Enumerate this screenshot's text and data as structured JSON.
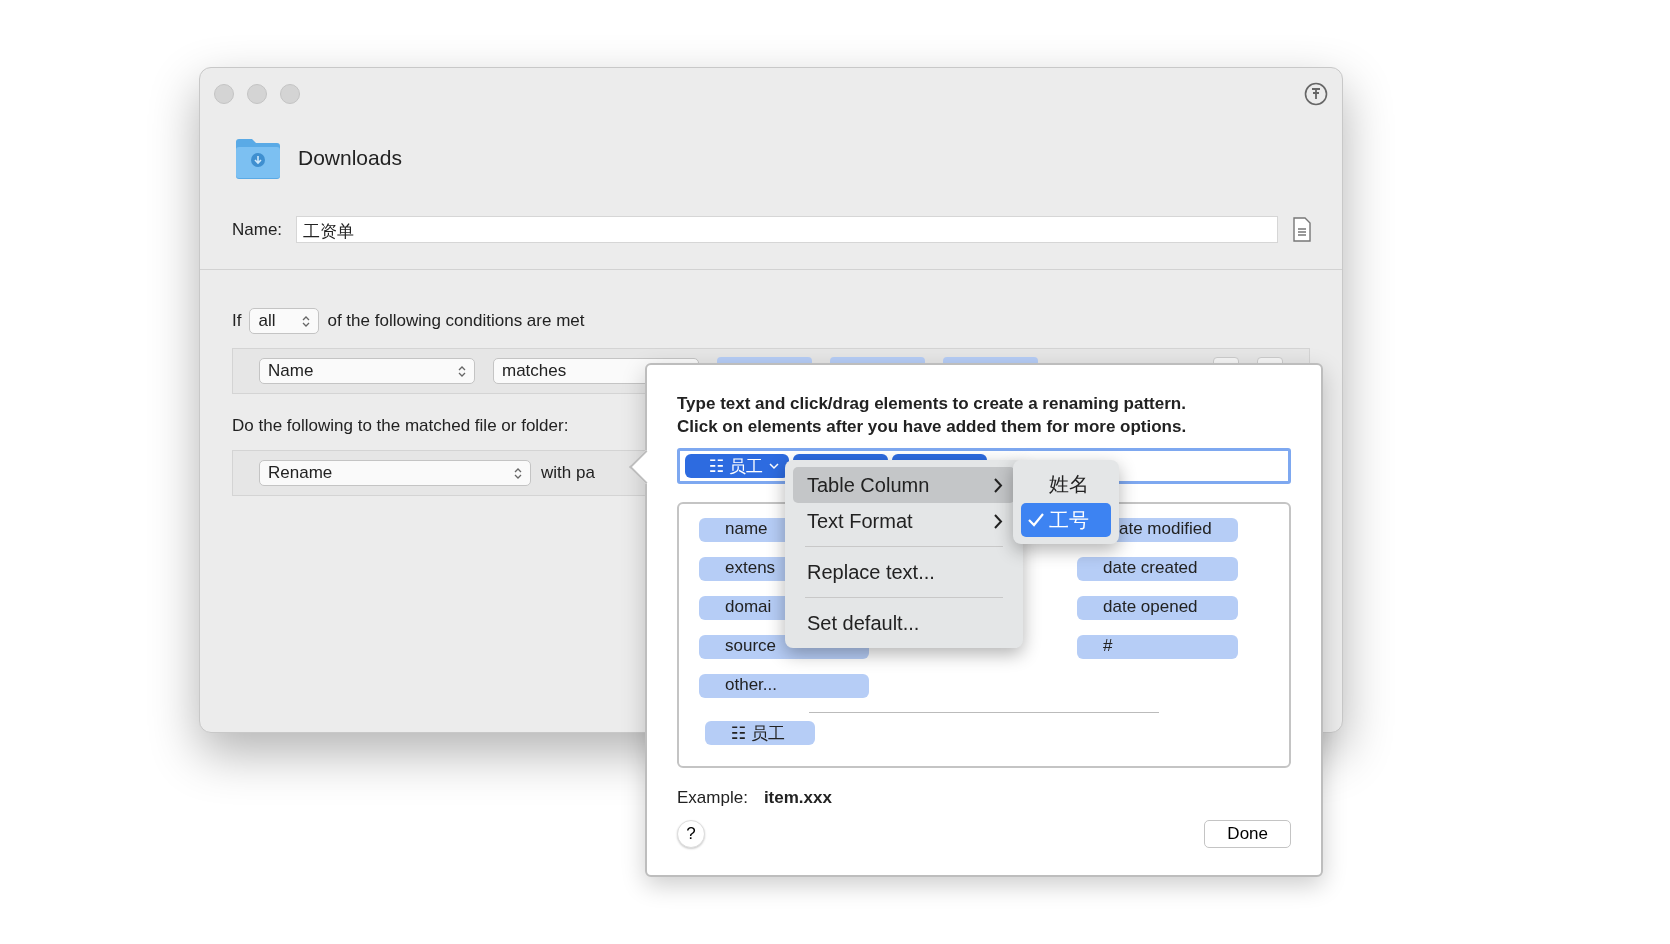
{
  "window": {
    "title": "Downloads",
    "name_label": "Name:",
    "name_value": "工资单",
    "conditions": {
      "prefix": "If",
      "quantifier": "all",
      "suffix": "of the following conditions are met",
      "attribute": "Name",
      "operator": "matches"
    },
    "actions_label": "Do the following to the matched file or folder:",
    "action": {
      "type": "Rename",
      "with_text": "with pa"
    }
  },
  "popover": {
    "instructions": [
      "Type text and click/drag elements to create a renaming pattern.",
      "Click on elements after you have added them for more options."
    ],
    "pattern_tokens": [
      {
        "label": "☷ 员工",
        "selected": true
      }
    ],
    "element_columns": [
      [
        "name",
        "extens",
        "domai",
        "source",
        "other..."
      ],
      [
        "ate modified",
        "date created",
        "date opened",
        "#"
      ]
    ],
    "custom_elements": [
      "☷ 员工"
    ],
    "example_label": "Example:",
    "example_value": "item.xxx",
    "help": "?",
    "done": "Done"
  },
  "menu": {
    "items": [
      {
        "kind": "submenu",
        "label": "Table Column",
        "selected": true
      },
      {
        "kind": "submenu",
        "label": "Text Format",
        "selected": false
      },
      {
        "kind": "separator"
      },
      {
        "kind": "item",
        "label": "Replace text...",
        "selected": false
      },
      {
        "kind": "separator"
      },
      {
        "kind": "item",
        "label": "Set default...",
        "selected": false
      }
    ]
  },
  "submenu": {
    "items": [
      {
        "label": "姓名",
        "checked": false,
        "selected": false
      },
      {
        "label": "工号",
        "checked": true,
        "selected": true
      }
    ]
  }
}
